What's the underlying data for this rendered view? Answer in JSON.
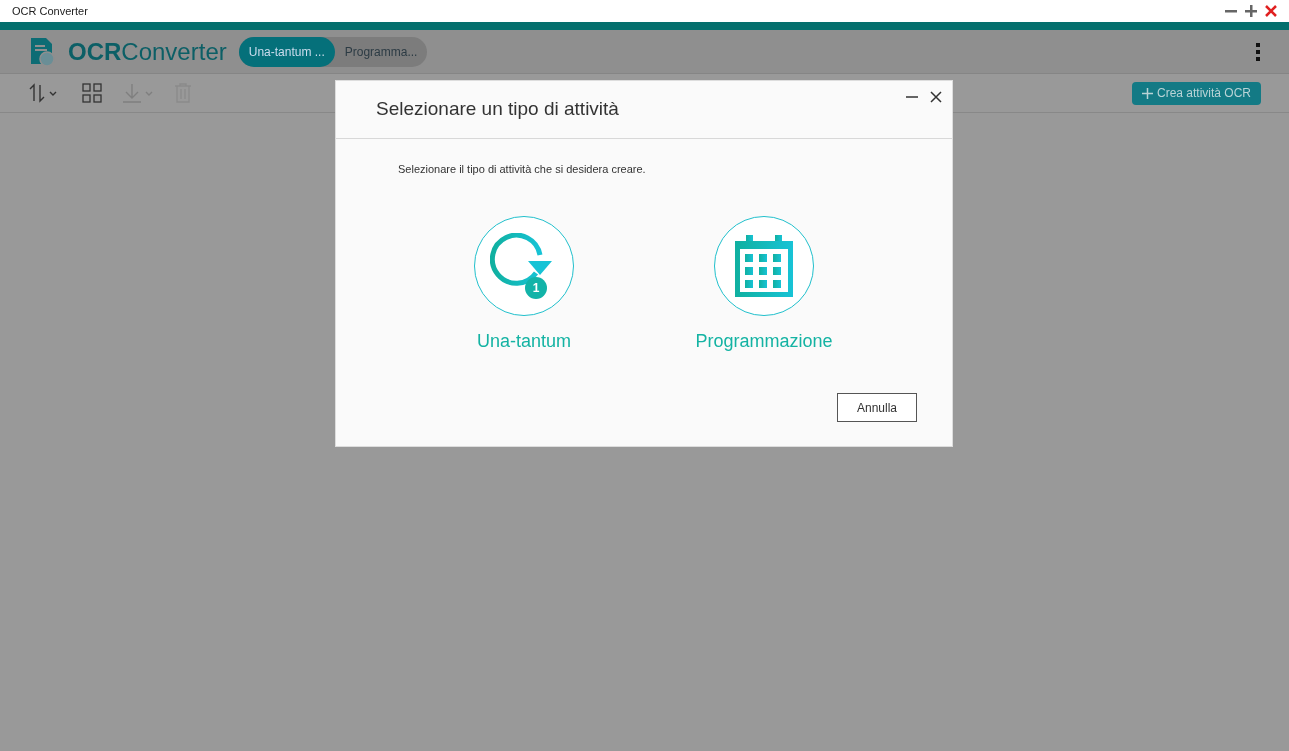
{
  "window": {
    "title": "OCR Converter"
  },
  "app": {
    "logo_bold": "OCR",
    "logo_light": "Converter"
  },
  "tabs": [
    {
      "label": "Una-tantum ...",
      "selected": true
    },
    {
      "label": "Programma...",
      "selected": false
    }
  ],
  "toolbar": {
    "create_button": "Crea attività OCR"
  },
  "dialog": {
    "title": "Selezionare un tipo di attività",
    "message": "Selezionare il tipo di attività che si desidera creare.",
    "options": [
      {
        "kind": "once",
        "label": "Una-tantum",
        "badge": "1"
      },
      {
        "kind": "schedule",
        "label": "Programmazione"
      }
    ],
    "cancel": "Annulla"
  }
}
